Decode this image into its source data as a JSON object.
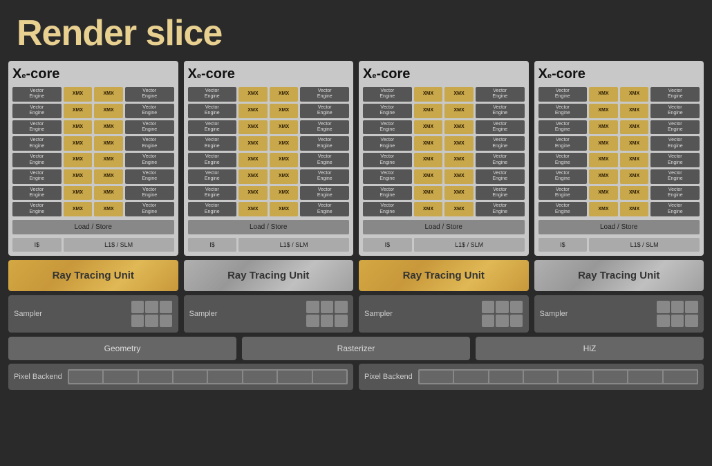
{
  "title": "Render slice",
  "xe_cores": [
    {
      "id": 1,
      "label_xe": "X",
      "label_e": "e",
      "label_core": "-core",
      "vector_rows": 8,
      "load_store": "Load / Store",
      "i_cache": "I$",
      "l1_cache": "L1$ / SLM",
      "ray_tracing": "Ray Tracing Unit",
      "ray_tracing_style": "gold",
      "sampler_label": "Sampler"
    },
    {
      "id": 2,
      "label_xe": "X",
      "label_e": "e",
      "label_core": "-core",
      "vector_rows": 8,
      "load_store": "Load / Store",
      "i_cache": "I$",
      "l1_cache": "L1$ / SLM",
      "ray_tracing": "Ray Tracing Unit",
      "ray_tracing_style": "silver",
      "sampler_label": "Sampler"
    },
    {
      "id": 3,
      "label_xe": "X",
      "label_e": "e",
      "label_core": "-core",
      "vector_rows": 8,
      "load_store": "Load / Store",
      "i_cache": "I$",
      "l1_cache": "L1$ / SLM",
      "ray_tracing": "Ray Tracing Unit",
      "ray_tracing_style": "gold",
      "sampler_label": "Sampler"
    },
    {
      "id": 4,
      "label_xe": "X",
      "label_e": "e",
      "label_core": "-core",
      "vector_rows": 8,
      "load_store": "Load / Store",
      "i_cache": "I$",
      "l1_cache": "L1$ / SLM",
      "ray_tracing": "Ray Tracing Unit",
      "ray_tracing_style": "silver",
      "sampler_label": "Sampler"
    }
  ],
  "bottom": {
    "geometry": "Geometry",
    "rasterizer": "Rasterizer",
    "hiz": "HiZ",
    "pixel_backend_1": "Pixel Backend",
    "pixel_backend_2": "Pixel Backend"
  }
}
